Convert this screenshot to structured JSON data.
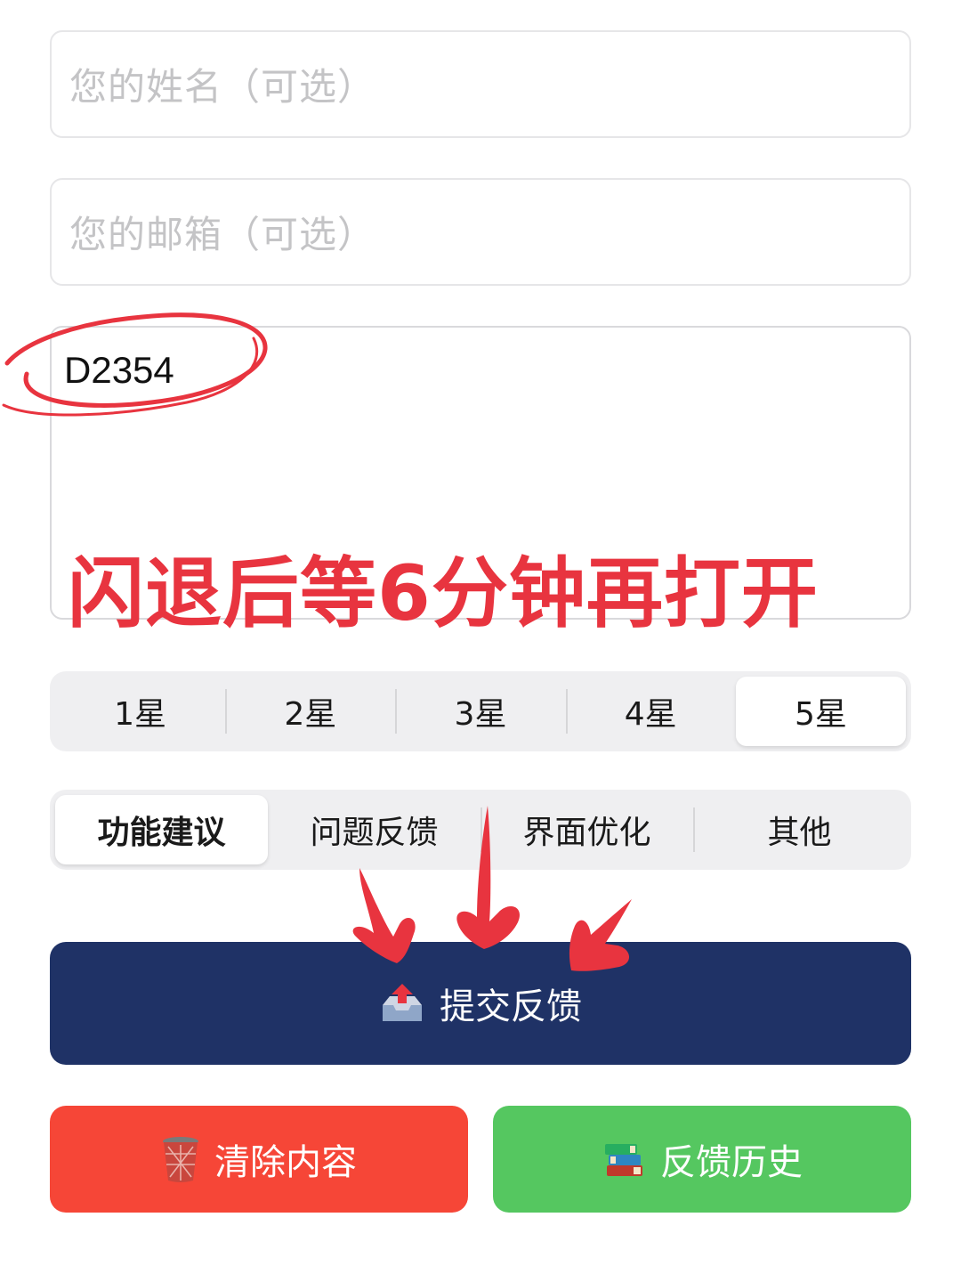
{
  "form": {
    "name_placeholder": "您的姓名（可选）",
    "email_placeholder": "您的邮箱（可选）",
    "feedback_text": "D2354"
  },
  "rating": {
    "options": [
      "1星",
      "2星",
      "3星",
      "4星",
      "5星"
    ],
    "selected": "5星"
  },
  "category": {
    "options": [
      "功能建议",
      "问题反馈",
      "界面优化",
      "其他"
    ],
    "selected": "功能建议"
  },
  "buttons": {
    "submit_label": "提交反馈",
    "submit_icon": "outbox-tray-icon",
    "clear_label": "清除内容",
    "clear_icon": "wastebasket-icon",
    "history_label": "反馈历史",
    "history_icon": "books-icon"
  },
  "annotation": {
    "text": "闪退后等6分钟再打开",
    "color": "#e8343f"
  },
  "colors": {
    "submit": "#1f3266",
    "clear": "#f64637",
    "history": "#55c760"
  }
}
